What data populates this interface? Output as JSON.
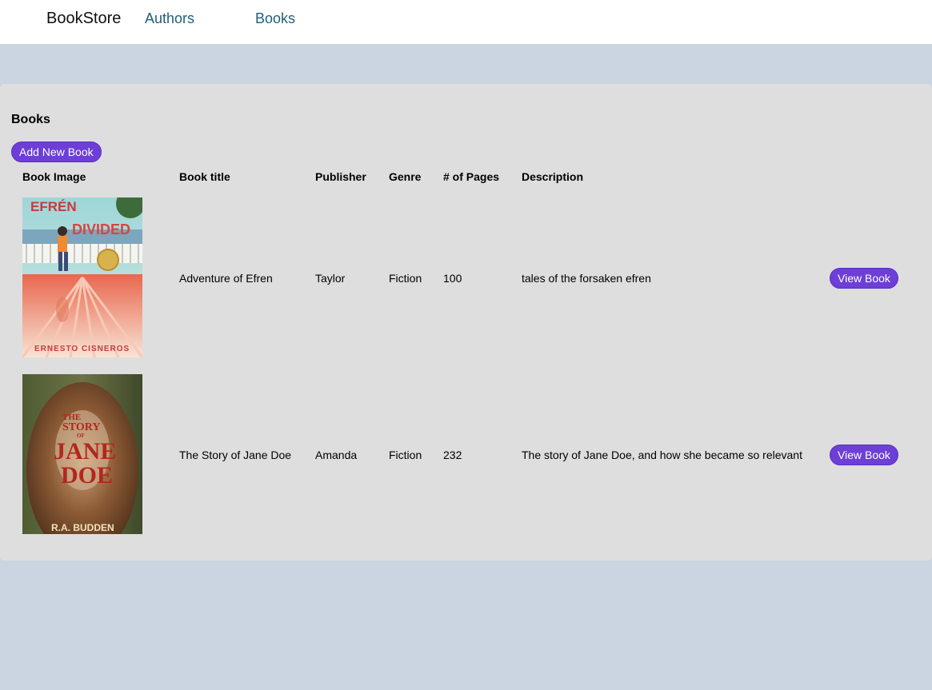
{
  "nav": {
    "brand": "BookStore",
    "links": [
      {
        "label": "Authors"
      },
      {
        "label": "Books"
      }
    ]
  },
  "page": {
    "title": "Books",
    "add_button_label": "Add New Book"
  },
  "table": {
    "headers": [
      "Book Image",
      "Book title",
      "Publisher",
      "Genre",
      "# of Pages",
      "Description"
    ],
    "rows": [
      {
        "cover_text": {
          "line1": "EFRÉN",
          "line2": "DIVIDED",
          "author": "ERNESTO CISNEROS"
        },
        "title": "Adventure of Efren",
        "publisher": "Taylor",
        "genre": "Fiction",
        "pages": "100",
        "description": "tales of the forsaken efren",
        "action_label": "View Book"
      },
      {
        "cover_text": {
          "line1": "THE",
          "line2": "STORY",
          "line3": "OF",
          "line4": "JANE",
          "line5": "DOE",
          "author": "R.A. BUDDEN"
        },
        "title": "The Story of Jane Doe",
        "publisher": "Amanda",
        "genre": "Fiction",
        "pages": "232",
        "description": "The story of Jane Doe, and how she became so relevant",
        "action_label": "View Book"
      }
    ]
  },
  "colors": {
    "page_bg": "#cbd5e1",
    "panel_bg": "#dedede",
    "button": "#6d3fd6",
    "nav_link": "#1f5f7a"
  }
}
